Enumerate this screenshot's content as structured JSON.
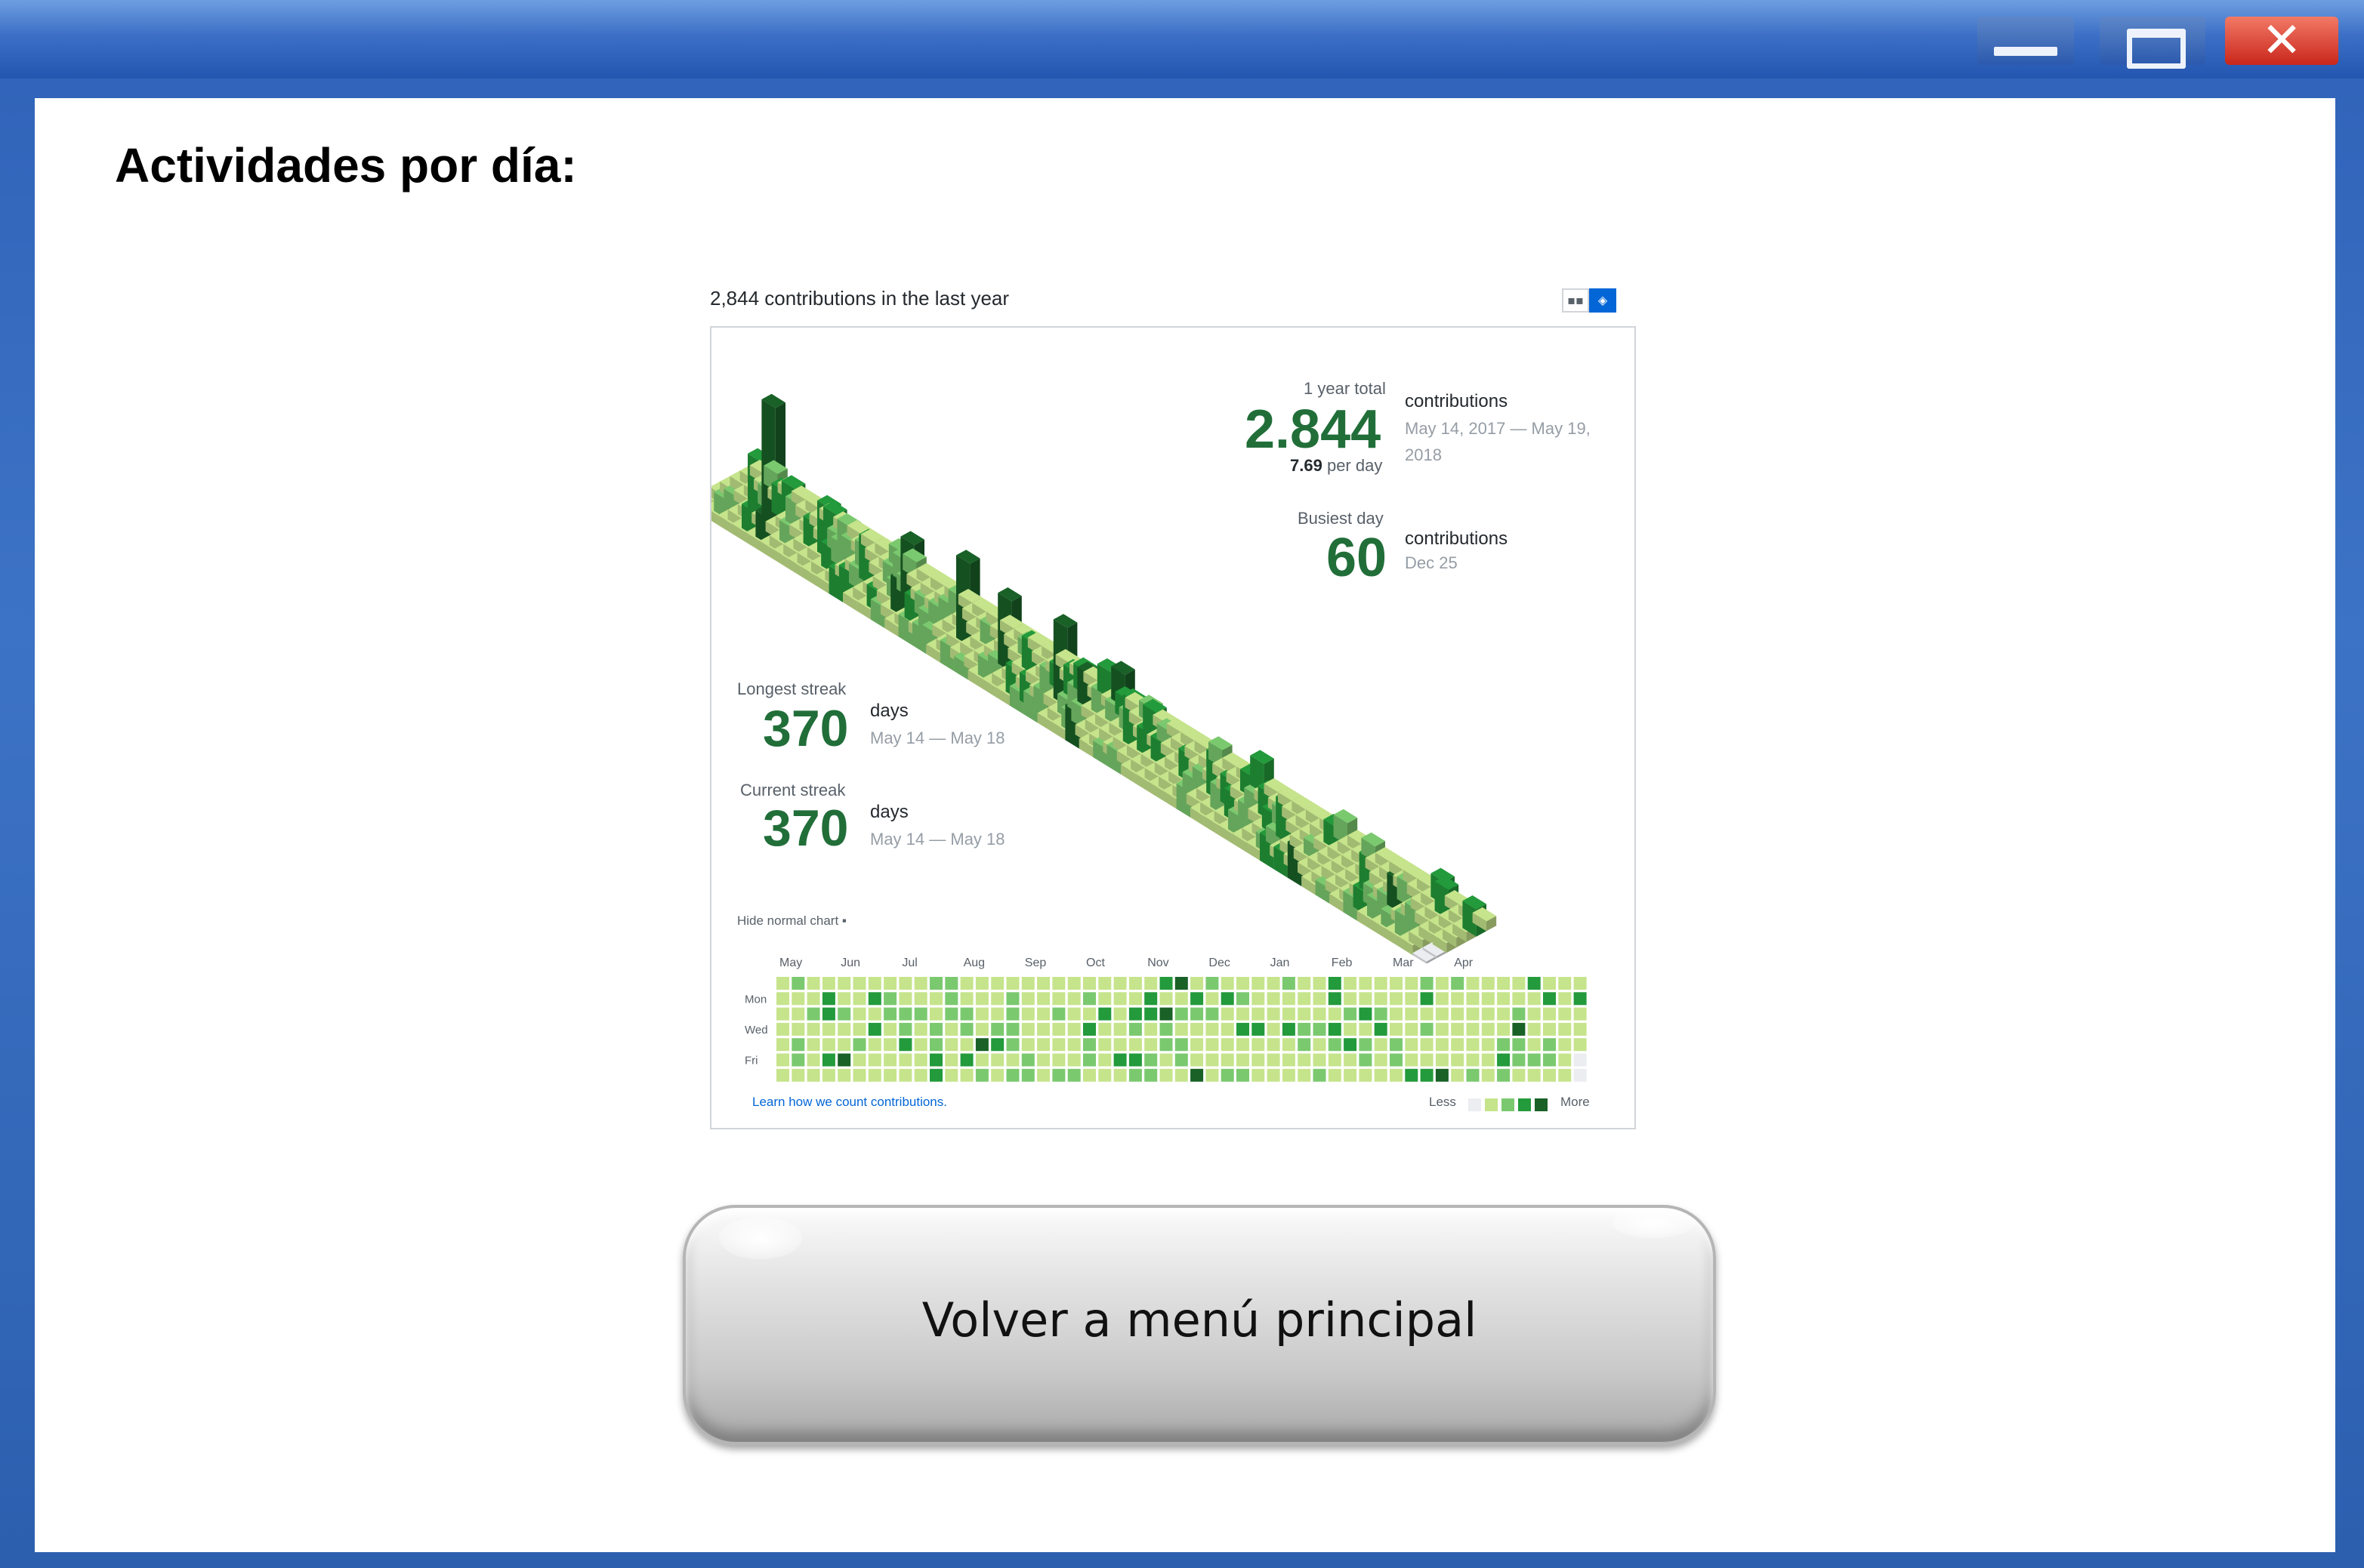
{
  "window": {
    "controls": [
      {
        "name": "minimize",
        "icon": "minimize-icon"
      },
      {
        "name": "maximize",
        "icon": "maximize-icon"
      },
      {
        "name": "close",
        "icon": "close-icon"
      }
    ],
    "close_glyph": "✕"
  },
  "page": {
    "heading": "Actividades por día:",
    "back_button_label": "Volver a menú principal"
  },
  "contributions": {
    "header": "2,844 contributions in the last year",
    "view_toggle": [
      {
        "icon": "grid-icon",
        "glyph": "▪▪",
        "selected": false
      },
      {
        "icon": "cube-icon",
        "glyph": "◈",
        "selected": true
      }
    ],
    "year_total": {
      "label": "1 year total",
      "value": "2.844",
      "unit": "contributions",
      "range": "May 14, 2017 — May 19, 2018",
      "per_day_value": "7.69",
      "per_day_label": "per day"
    },
    "busiest_day": {
      "label": "Busiest day",
      "value": "60",
      "unit": "contributions",
      "date": "Dec 25"
    },
    "longest_streak": {
      "label": "Longest streak",
      "value": "370",
      "unit": "days",
      "range": "May 14 — May 18"
    },
    "current_streak": {
      "label": "Current streak",
      "value": "370",
      "unit": "days",
      "range": "May 14 — May 18"
    },
    "hide_chart_label": "Hide normal chart ▪",
    "months": [
      "May",
      "Jun",
      "Jul",
      "Aug",
      "Sep",
      "Oct",
      "Nov",
      "Dec",
      "Jan",
      "Feb",
      "Mar",
      "Apr"
    ],
    "weekdays": [
      "Mon",
      "Wed",
      "Fri"
    ],
    "learn_link": "Learn how we count contributions.",
    "legend_less": "Less",
    "legend_more": "More",
    "palette": [
      "#ebedf0",
      "#c6e48b",
      "#7bc96f",
      "#239a3b",
      "#196127"
    ],
    "weeks": 53,
    "tall_bars": [
      {
        "week": 3,
        "level": 4,
        "count": 60
      },
      {
        "week": 2,
        "level": 3,
        "count": 28
      },
      {
        "week": 7,
        "level": 3,
        "count": 26
      },
      {
        "week": 10,
        "level": 3,
        "count": 22
      },
      {
        "week": 13,
        "level": 4,
        "count": 34
      },
      {
        "week": 17,
        "level": 4,
        "count": 42
      },
      {
        "week": 20,
        "level": 4,
        "count": 36
      },
      {
        "week": 24,
        "level": 4,
        "count": 40
      },
      {
        "week": 29,
        "level": 3,
        "count": 24
      },
      {
        "week": 35,
        "level": 3,
        "count": 22
      },
      {
        "week": 40,
        "level": 3,
        "count": 20
      },
      {
        "week": 46,
        "level": 3,
        "count": 18
      }
    ]
  }
}
